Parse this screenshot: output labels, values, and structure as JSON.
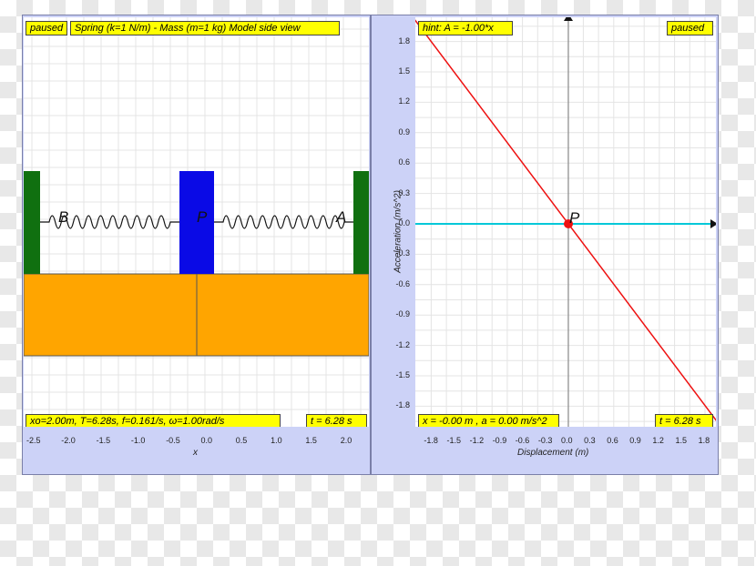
{
  "left": {
    "status": "paused",
    "title": "Spring (k=1 N/m) - Mass (m=1 kg) Model side view",
    "info": "xo=2.00m, T=6.28s, f=0.161/s, ω=1.00rad/s",
    "time": "t = 6.28 s",
    "xticks": [
      "-2.5",
      "-2.0",
      "-1.5",
      "-1.0",
      "-0.5",
      "0.0",
      "0.5",
      "1.0",
      "1.5",
      "2.0"
    ],
    "xlabel": "x",
    "labels": {
      "b": "B",
      "p": "P",
      "a": "A"
    },
    "colors": {
      "wall": "#107010",
      "mass": "#0a0ae6",
      "floor": "#ffa500"
    }
  },
  "right": {
    "hint": "hint: A = -1.00*x",
    "status": "paused",
    "info": "x = -0.00 m , a = 0.00 m/s^2",
    "time": "t = 6.28 s",
    "yticks": [
      "1.8",
      "1.5",
      "1.2",
      "0.9",
      "0.6",
      "0.3",
      "0.0",
      "-0.3",
      "-0.6",
      "-0.9",
      "-1.2",
      "-1.5",
      "-1.8"
    ],
    "xticks": [
      "-1.8",
      "-1.5",
      "-1.2",
      "-0.9",
      "-0.6",
      "-0.3",
      "0.0",
      "0.3",
      "0.6",
      "0.9",
      "1.2",
      "1.5",
      "1.8"
    ],
    "xlabel": "Displacement (m)",
    "ylabel": "Acceleration (m/s^2)",
    "point_label": "P",
    "colors": {
      "line": "#ee1111",
      "hline": "#00c8d8",
      "point": "#ee1111"
    }
  }
}
